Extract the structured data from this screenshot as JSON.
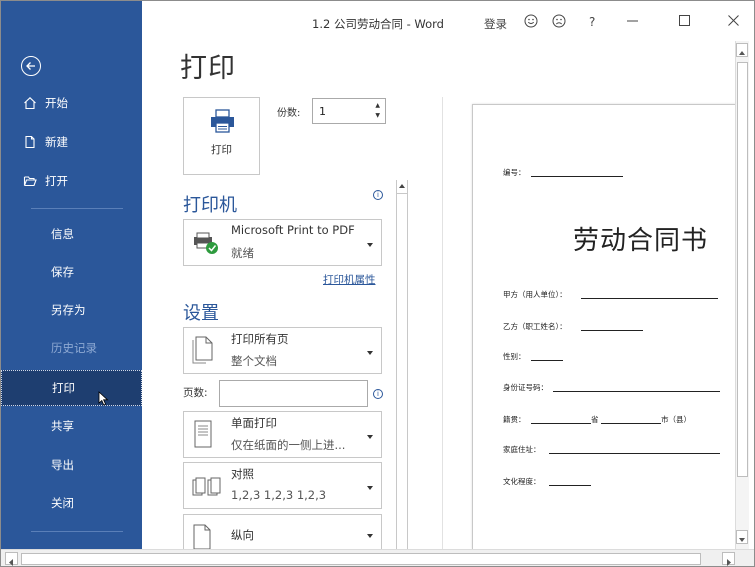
{
  "window": {
    "title": "1.2 公司劳动合同 - Word",
    "login": "登录",
    "help": "?"
  },
  "sidebar": {
    "items": [
      {
        "label": "开始"
      },
      {
        "label": "新建"
      },
      {
        "label": "打开"
      },
      {
        "label": "信息"
      },
      {
        "label": "保存"
      },
      {
        "label": "另存为"
      },
      {
        "label": "历史记录"
      },
      {
        "label": "打印"
      },
      {
        "label": "共享"
      },
      {
        "label": "导出"
      },
      {
        "label": "关闭"
      }
    ]
  },
  "print": {
    "page_title": "打印",
    "print_button_label": "打印",
    "copies_label": "份数:",
    "copies_value": "1",
    "printer_heading": "打印机",
    "printer_name": "Microsoft Print to PDF",
    "printer_status": "就绪",
    "printer_properties": "打印机属性",
    "settings_heading": "设置",
    "settings": [
      {
        "line1": "打印所有页",
        "line2": "整个文档"
      },
      {
        "line1": "单面打印",
        "line2": "仅在纸面的一侧上进..."
      },
      {
        "line1": "对照",
        "line2": "1,2,3   1,2,3   1,2,3"
      },
      {
        "line1": "纵向",
        "line2": ""
      }
    ],
    "pages_label": "页数:",
    "pages_value": ""
  },
  "preview": {
    "doc_title": "劳动合同书",
    "fields": {
      "number": "编号：",
      "party_a": "甲方（用人单位）：",
      "party_b": "乙方（职工姓名）：",
      "gender": "性别：",
      "id_number": "身份证号码：",
      "native_place": "籍贯：",
      "province": "省",
      "city": "市（县）",
      "home_address": "家庭住址：",
      "education": "文化程度："
    }
  },
  "colors": {
    "sidebar_bg": "#2b579a",
    "sidebar_selected": "#1e3e70",
    "accent": "#2b579a"
  }
}
